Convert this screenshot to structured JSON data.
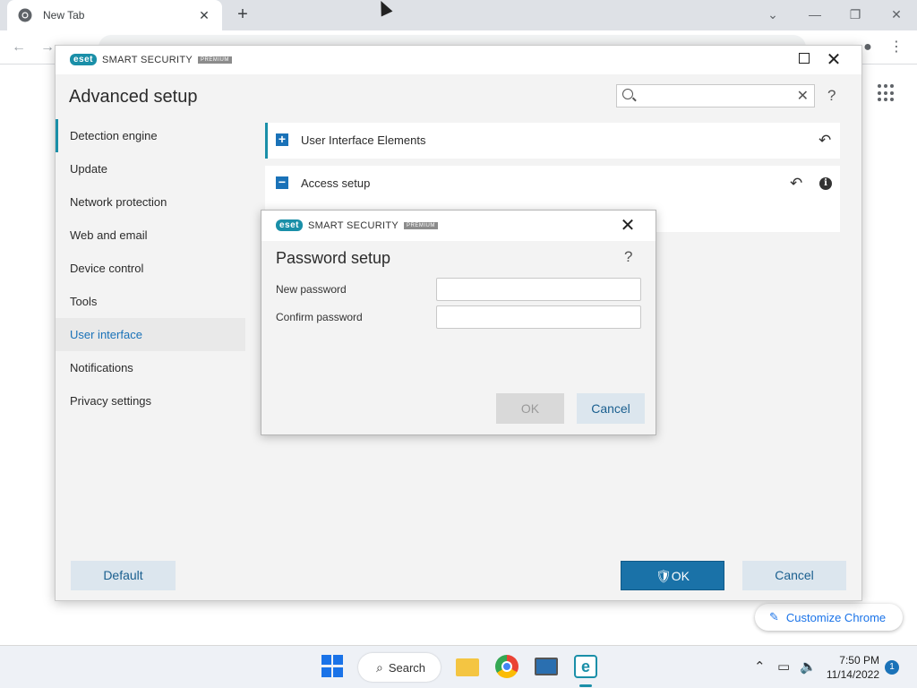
{
  "browser": {
    "tab_title": "New Tab",
    "tab_close": "✕",
    "new_tab": "+",
    "window_controls": [
      "⌄",
      "—",
      "❐",
      "✕"
    ],
    "customize_label": "Customize Chrome"
  },
  "eset": {
    "brand": "eset",
    "product": "SMART SECURITY",
    "tier": "PREMIUM",
    "page_title": "Advanced setup",
    "search": {
      "value": "",
      "placeholder": ""
    },
    "help": "?",
    "nav": [
      "Detection engine",
      "Update",
      "Network protection",
      "Web and email",
      "Device control",
      "Tools",
      "User interface",
      "Notifications",
      "Privacy settings"
    ],
    "active_nav": "User interface",
    "sections": [
      {
        "label": "User Interface Elements",
        "expanded": false
      },
      {
        "label": "Access setup",
        "expanded": true
      }
    ],
    "buttons": {
      "default": "Default",
      "ok": "OK",
      "cancel": "Cancel"
    },
    "accent": "#1a8fa8"
  },
  "dialog": {
    "brand": "eset",
    "product": "SMART SECURITY",
    "tier": "PREMIUM",
    "title": "Password setup",
    "help": "?",
    "fields": [
      {
        "label": "New password",
        "value": ""
      },
      {
        "label": "Confirm password",
        "value": ""
      }
    ],
    "ok": "OK",
    "cancel": "Cancel"
  },
  "taskbar": {
    "search_label": "Search",
    "time": "7:50 PM",
    "date": "11/14/2022",
    "notifications": "1"
  }
}
